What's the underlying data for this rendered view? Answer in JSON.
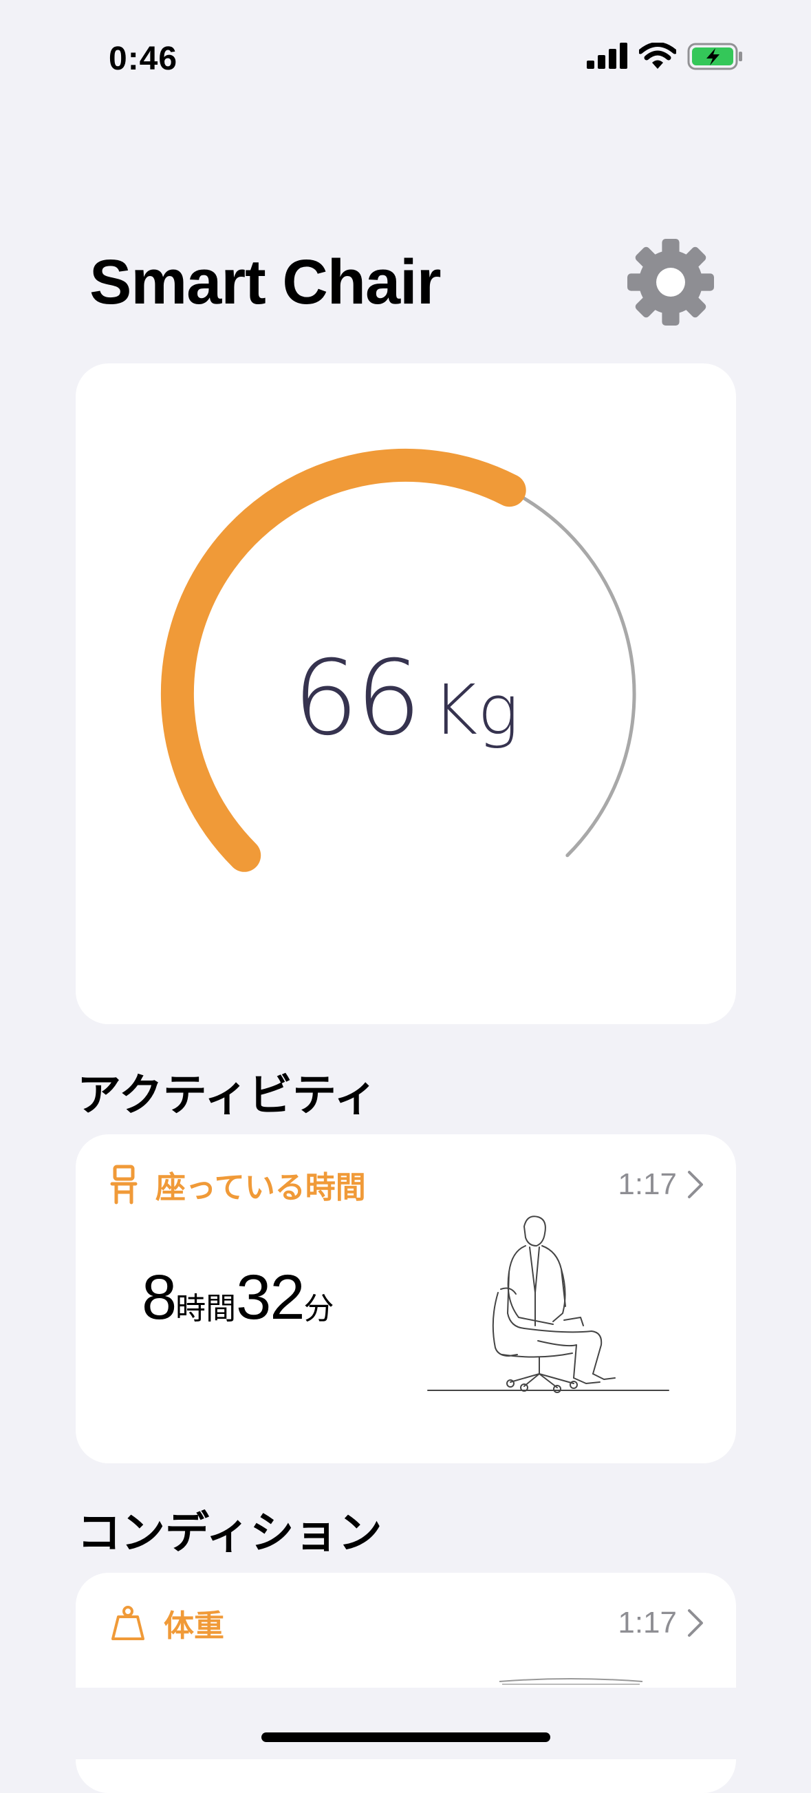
{
  "status_bar": {
    "time": "0:46"
  },
  "header": {
    "title": "Smart Chair"
  },
  "weight_gauge": {
    "value": "66",
    "unit": "Kg",
    "fill_fraction": 0.6,
    "accent_color": "#f09a38"
  },
  "activity": {
    "section_title": "アクティビティ",
    "card": {
      "title": "座っている時間",
      "time": "1:17",
      "hours": "8",
      "hours_unit": "時間",
      "minutes": "32",
      "minutes_unit": "分"
    }
  },
  "condition": {
    "section_title": "コンディション",
    "card": {
      "title": "体重",
      "time": "1:17"
    }
  },
  "icons": {
    "signal": "cellular-signal-icon",
    "wifi": "wifi-icon",
    "battery": "battery-charging-icon",
    "settings": "gear-icon",
    "chair": "chair-icon",
    "scale": "scale-weight-icon",
    "chevron": "chevron-right-icon"
  }
}
